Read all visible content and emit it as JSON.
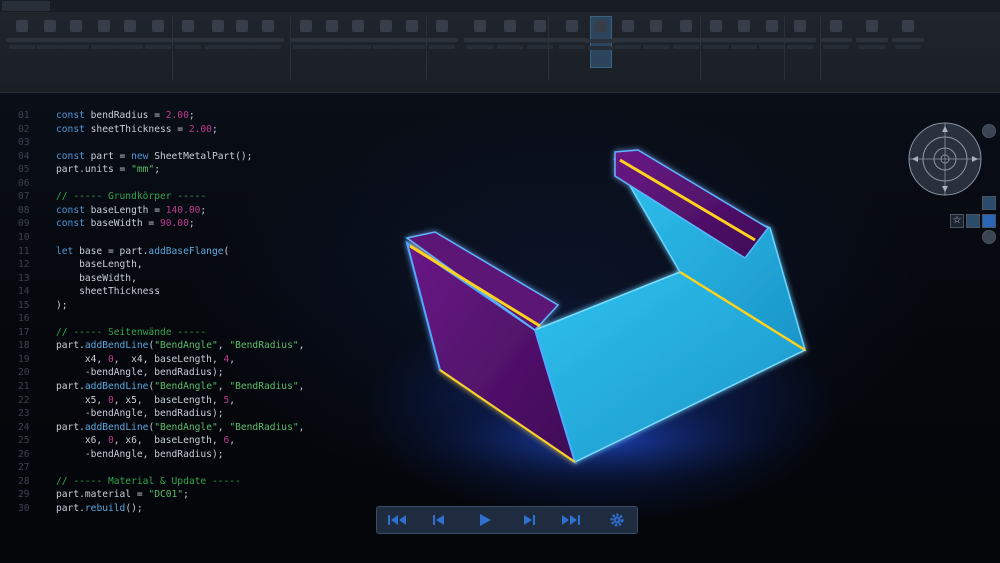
{
  "ribbon": {
    "tabs": [
      "",
      "",
      "",
      "",
      "",
      "",
      ""
    ],
    "groups": [
      "",
      "",
      "",
      "",
      "",
      "",
      "",
      ""
    ]
  },
  "editor": {
    "lines": [
      {
        "n": "01",
        "parts": [
          [
            "kw",
            "const "
          ],
          [
            "id",
            "bendRadius = "
          ],
          [
            "nm",
            "2.00"
          ],
          [
            "id",
            ";"
          ]
        ]
      },
      {
        "n": "02",
        "parts": [
          [
            "kw",
            "const "
          ],
          [
            "id",
            "sheetThickness = "
          ],
          [
            "nm",
            "2.00"
          ],
          [
            "id",
            ";"
          ]
        ]
      },
      {
        "n": "03",
        "parts": []
      },
      {
        "n": "04",
        "parts": [
          [
            "kw",
            "const "
          ],
          [
            "id",
            "part = "
          ],
          [
            "kw",
            "new "
          ],
          [
            "id",
            "SheetMetalPart();"
          ]
        ]
      },
      {
        "n": "05",
        "parts": [
          [
            "id",
            "part.units = "
          ],
          [
            "st",
            "\"mm\""
          ],
          [
            "id",
            ";"
          ]
        ]
      },
      {
        "n": "06",
        "parts": []
      },
      {
        "n": "07",
        "parts": [
          [
            "cm",
            "// ----- Grundkörper -----"
          ]
        ]
      },
      {
        "n": "08",
        "parts": [
          [
            "kw",
            "const "
          ],
          [
            "id",
            "baseLength = "
          ],
          [
            "nm",
            "140.00"
          ],
          [
            "id",
            ";"
          ]
        ]
      },
      {
        "n": "09",
        "parts": [
          [
            "kw",
            "const "
          ],
          [
            "id",
            "baseWidth = "
          ],
          [
            "nm",
            "90.00"
          ],
          [
            "id",
            ";"
          ]
        ]
      },
      {
        "n": "10",
        "parts": []
      },
      {
        "n": "11",
        "parts": [
          [
            "kw",
            "let "
          ],
          [
            "id",
            "base = part."
          ],
          [
            "fn",
            "addBaseFlange"
          ],
          [
            "id",
            "("
          ]
        ]
      },
      {
        "n": "12",
        "parts": [
          [
            "id",
            "    baseLength,"
          ]
        ]
      },
      {
        "n": "13",
        "parts": [
          [
            "id",
            "    baseWidth,"
          ]
        ]
      },
      {
        "n": "14",
        "parts": [
          [
            "id",
            "    sheetThickness"
          ]
        ]
      },
      {
        "n": "15",
        "parts": [
          [
            "id",
            ");"
          ]
        ]
      },
      {
        "n": "16",
        "parts": []
      },
      {
        "n": "17",
        "parts": [
          [
            "cm",
            "// ----- Seitenwände -----"
          ]
        ]
      },
      {
        "n": "18",
        "parts": [
          [
            "id",
            "part."
          ],
          [
            "fn",
            "addBendLine"
          ],
          [
            "id",
            "("
          ],
          [
            "st",
            "\"BendAngle\""
          ],
          [
            "id",
            ", "
          ],
          [
            "st",
            "\"BendRadius\""
          ],
          [
            "id",
            ","
          ]
        ]
      },
      {
        "n": "19",
        "parts": [
          [
            "id",
            "     x4, "
          ],
          [
            "nm",
            "0"
          ],
          [
            "id",
            ",  x4, baseLength, "
          ],
          [
            "nm",
            "4"
          ],
          [
            "id",
            ","
          ]
        ]
      },
      {
        "n": "20",
        "parts": [
          [
            "id",
            "     -bendAngle, bendRadius);"
          ]
        ]
      },
      {
        "n": "21",
        "parts": [
          [
            "id",
            "part."
          ],
          [
            "fn",
            "addBendLine"
          ],
          [
            "id",
            "("
          ],
          [
            "st",
            "\"BendAngle\""
          ],
          [
            "id",
            ", "
          ],
          [
            "st",
            "\"BendRadius\""
          ],
          [
            "id",
            ","
          ]
        ]
      },
      {
        "n": "22",
        "parts": [
          [
            "id",
            "     x5, "
          ],
          [
            "nm",
            "0"
          ],
          [
            "id",
            ", x5,  baseLength, "
          ],
          [
            "nm",
            "5"
          ],
          [
            "id",
            ","
          ]
        ]
      },
      {
        "n": "23",
        "parts": [
          [
            "id",
            "     -bendAngle, bendRadius);"
          ]
        ]
      },
      {
        "n": "24",
        "parts": [
          [
            "id",
            "part."
          ],
          [
            "fn",
            "addBendLine"
          ],
          [
            "id",
            "("
          ],
          [
            "st",
            "\"BendAngle\""
          ],
          [
            "id",
            ", "
          ],
          [
            "st",
            "\"BendRadius\""
          ],
          [
            "id",
            ","
          ]
        ]
      },
      {
        "n": "25",
        "parts": [
          [
            "id",
            "     x6, "
          ],
          [
            "nm",
            "0"
          ],
          [
            "id",
            ", x6,  baseLength, "
          ],
          [
            "nm",
            "6"
          ],
          [
            "id",
            ","
          ]
        ]
      },
      {
        "n": "26",
        "parts": [
          [
            "id",
            "     -bendAngle, bendRadius);"
          ]
        ]
      },
      {
        "n": "27",
        "parts": []
      },
      {
        "n": "28",
        "parts": [
          [
            "cm",
            "// ----- Material & Update -----"
          ]
        ]
      },
      {
        "n": "29",
        "parts": [
          [
            "id",
            "part.material = "
          ],
          [
            "st",
            "\"DC01\""
          ],
          [
            "id",
            ";"
          ]
        ]
      },
      {
        "n": "30",
        "parts": [
          [
            "id",
            "part."
          ],
          [
            "fn",
            "rebuild"
          ],
          [
            "id",
            "();"
          ]
        ]
      }
    ]
  },
  "viewport": {
    "model_colors": {
      "inner": "#27b7e8",
      "wall": "#5a1372",
      "edge": "#ffd21a",
      "glow": "#3fa8ff"
    }
  },
  "playback": {
    "buttons": [
      "first-frame-icon",
      "prev-frame-icon",
      "play-icon",
      "next-frame-icon",
      "last-frame-icon",
      "settings-gear-icon"
    ]
  },
  "colors": {
    "background": "#05070c",
    "ribbon": "#1f242b",
    "accent": "#2f6fd0"
  }
}
